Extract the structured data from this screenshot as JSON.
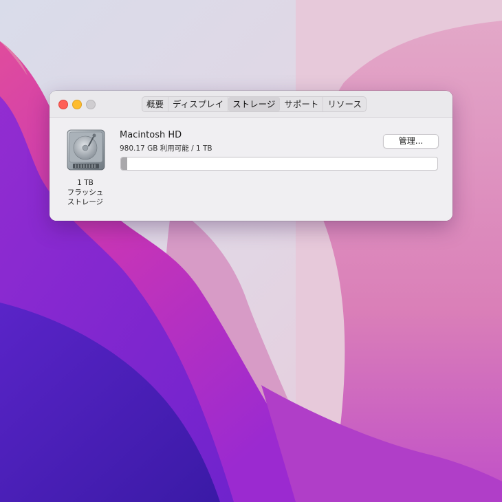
{
  "window": {
    "tabs": [
      {
        "label": "概要"
      },
      {
        "label": "ディスプレイ"
      },
      {
        "label": "ストレージ"
      },
      {
        "label": "サポート"
      },
      {
        "label": "リソース"
      }
    ],
    "active_tab": "ストレージ"
  },
  "storage": {
    "disk_icon": "hard-drive-icon",
    "disk_capacity": "1 TB",
    "disk_type_line1": "フラッシュ",
    "disk_type_line2": "ストレージ",
    "volume_name": "Macintosh HD",
    "available_text": "980.17 GB 利用可能 / 1 TB",
    "used_fraction": 0.0198,
    "manage_label": "管理..."
  },
  "colors": {
    "close": "#fe5f57",
    "minimize": "#febc2e",
    "zoom_inactive": "#cfcdd0"
  }
}
